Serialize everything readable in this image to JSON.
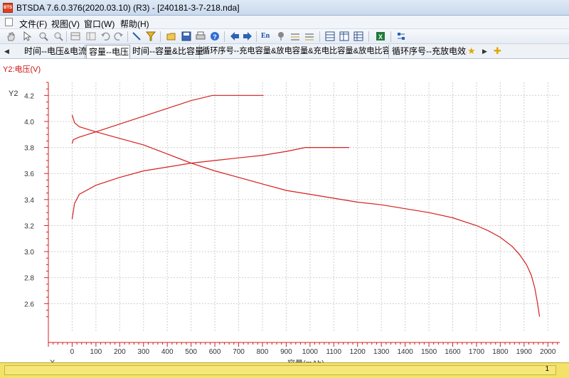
{
  "window": {
    "app_icon_text": "BTS",
    "title": "BTSDA 7.6.0.376(2020.03.10) (R3) - [240181-3-7-218.nda]"
  },
  "menu": {
    "items": [
      {
        "id": "file",
        "label": "文件(F)"
      },
      {
        "id": "view",
        "label": "视图(V)"
      },
      {
        "id": "window",
        "label": "窗口(W)"
      },
      {
        "id": "help",
        "label": "帮助(H)"
      }
    ]
  },
  "toolbar": {
    "icons": [
      "hand-icon",
      "pointer-icon",
      "zoom-in-icon",
      "zoom-out-icon",
      "table-icon",
      "undo-icon",
      "redo-icon",
      "line-tool-icon",
      "filter-icon",
      "open-folder-icon",
      "save-icon",
      "print-icon",
      "help-icon",
      "back-icon",
      "forward-icon",
      "language-en-icon",
      "pin-icon",
      "layers-icon",
      "layers-alt-icon",
      "grid-icon",
      "grid-alt-icon",
      "grid-report-icon",
      "excel-icon",
      "settings-icon"
    ],
    "language_label": "En"
  },
  "tabs": {
    "items": [
      {
        "label": "时间--电压&电流",
        "active": false
      },
      {
        "label": "容量--电压",
        "active": true
      },
      {
        "label": "时间--容量&比容量",
        "active": false
      },
      {
        "label": "循环序号--充电容量&放电容量&充电比容量&放电比容量",
        "active": false
      },
      {
        "label": "循环序号--充放电效率",
        "active": false
      }
    ]
  },
  "status": {
    "page_number": "1"
  },
  "colors": {
    "curve": "#d42020",
    "axis": "#d42020",
    "status_bar": "#f3e267"
  },
  "chart_data": {
    "type": "line",
    "title": "",
    "series_label": "Y2:电压(V)",
    "ylabel": "Y2",
    "xlabel_prefix": "X",
    "xlabel": "容量(mAh)",
    "xlim": [
      -100,
      2050
    ],
    "ylim": [
      2.4,
      4.3
    ],
    "x_ticks": [
      0,
      100,
      200,
      300,
      400,
      500,
      600,
      700,
      800,
      900,
      1000,
      1100,
      1200,
      1300,
      1400,
      1500,
      1600,
      1700,
      1800,
      1900,
      2000
    ],
    "y_ticks": [
      2.6,
      2.8,
      3.0,
      3.2,
      3.4,
      3.6,
      3.8,
      4.0,
      4.2
    ],
    "grid": true,
    "series": [
      {
        "values": [
          [
            0,
            3.83
          ],
          [
            5,
            3.86
          ],
          [
            30,
            3.88
          ],
          [
            100,
            3.92
          ],
          [
            200,
            3.98
          ],
          [
            300,
            4.04
          ],
          [
            400,
            4.1
          ],
          [
            500,
            4.16
          ],
          [
            590,
            4.2
          ],
          [
            700,
            4.2
          ],
          [
            805,
            4.2
          ]
        ]
      },
      {
        "values": [
          [
            0,
            4.05
          ],
          [
            10,
            3.99
          ],
          [
            30,
            3.96
          ],
          [
            100,
            3.92
          ],
          [
            200,
            3.87
          ],
          [
            300,
            3.82
          ],
          [
            400,
            3.75
          ],
          [
            500,
            3.68
          ],
          [
            600,
            3.62
          ],
          [
            700,
            3.57
          ],
          [
            800,
            3.52
          ],
          [
            900,
            3.47
          ],
          [
            1000,
            3.44
          ],
          [
            1100,
            3.41
          ],
          [
            1200,
            3.38
          ],
          [
            1300,
            3.36
          ],
          [
            1400,
            3.33
          ],
          [
            1500,
            3.3
          ],
          [
            1600,
            3.26
          ],
          [
            1700,
            3.2
          ],
          [
            1750,
            3.16
          ],
          [
            1800,
            3.11
          ],
          [
            1850,
            3.04
          ],
          [
            1880,
            2.98
          ],
          [
            1910,
            2.9
          ],
          [
            1930,
            2.82
          ],
          [
            1945,
            2.72
          ],
          [
            1955,
            2.62
          ],
          [
            1965,
            2.5
          ]
        ]
      },
      {
        "values": [
          [
            0,
            3.25
          ],
          [
            10,
            3.37
          ],
          [
            30,
            3.44
          ],
          [
            100,
            3.51
          ],
          [
            200,
            3.57
          ],
          [
            300,
            3.62
          ],
          [
            400,
            3.65
          ],
          [
            500,
            3.68
          ],
          [
            600,
            3.7
          ],
          [
            700,
            3.72
          ],
          [
            800,
            3.74
          ],
          [
            900,
            3.77
          ],
          [
            980,
            3.8
          ],
          [
            1100,
            3.8
          ],
          [
            1165,
            3.8
          ]
        ]
      }
    ]
  }
}
